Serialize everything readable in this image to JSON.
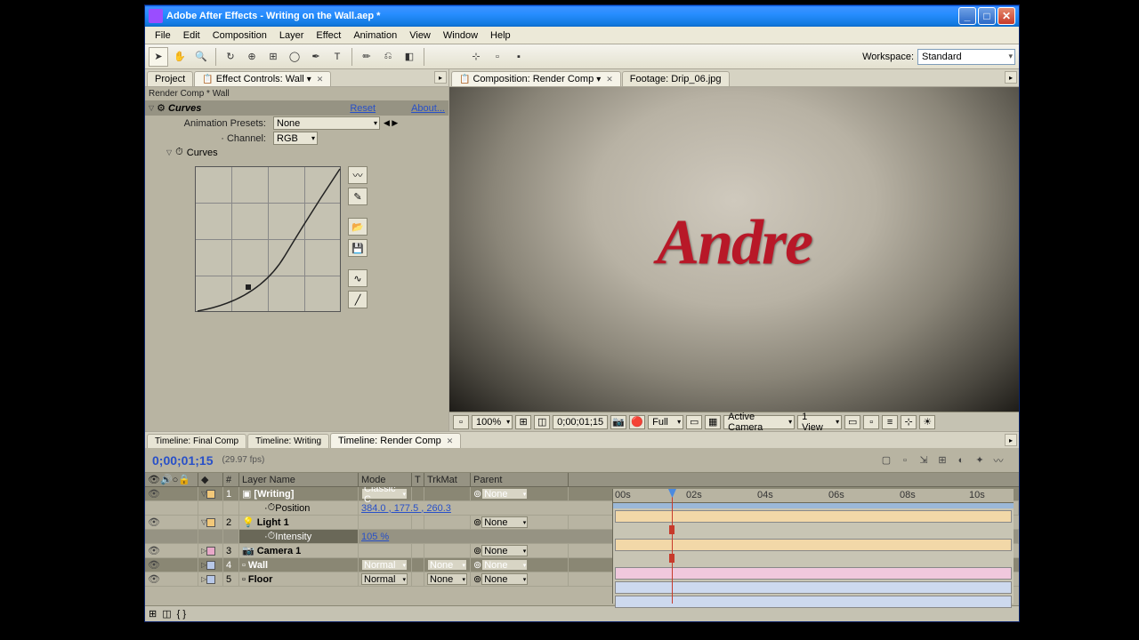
{
  "window": {
    "title": "Adobe After Effects - Writing on the Wall.aep *"
  },
  "menu": [
    "File",
    "Edit",
    "Composition",
    "Layer",
    "Effect",
    "Animation",
    "View",
    "Window",
    "Help"
  ],
  "workspace": {
    "label": "Workspace:",
    "value": "Standard"
  },
  "left_tabs": {
    "project": "Project",
    "effect": "Effect Controls: Wall"
  },
  "effect": {
    "breadcrumb": "Render Comp * Wall",
    "name": "Curves",
    "reset": "Reset",
    "about": "About...",
    "presets_label": "Animation Presets:",
    "presets_value": "None",
    "channel_label": "Channel:",
    "channel_value": "RGB",
    "curves_label": "Curves"
  },
  "comp_tabs": {
    "comp": "Composition: Render Comp",
    "footage": "Footage: Drip_06.jpg"
  },
  "graffiti_text": "Andre",
  "viewer": {
    "zoom": "100%",
    "time": "0;00;01;15",
    "res": "Full",
    "camera": "Active Camera",
    "views": "1 View"
  },
  "tl_tabs": [
    "Timeline: Final Comp",
    "Timeline: Writing",
    "Timeline: Render Comp"
  ],
  "tl": {
    "timecode": "0;00;01;15",
    "fps": "(29.97 fps)",
    "col_num": "#",
    "col_name": "Layer Name",
    "col_mode": "Mode",
    "col_t": "T",
    "col_trk": "TrkMat",
    "col_parent": "Parent"
  },
  "layers": [
    {
      "n": "1",
      "name": "[Writing]",
      "mode": "Classic C",
      "trk": "",
      "parent": "None",
      "color": "#f2c879"
    },
    {
      "prop": "Position",
      "val": "384.0 , 177.5 , 260.3"
    },
    {
      "n": "2",
      "name": "Light 1",
      "mode": "",
      "trk": "",
      "parent": "None",
      "color": "#f2c879"
    },
    {
      "prop": "Intensity",
      "val": "105 %"
    },
    {
      "n": "3",
      "name": "Camera 1",
      "mode": "",
      "trk": "",
      "parent": "None",
      "color": "#e8a8c8"
    },
    {
      "n": "4",
      "name": "Wall",
      "mode": "Normal",
      "trk": "None",
      "parent": "None",
      "color": "#b8c8e8"
    },
    {
      "n": "5",
      "name": "Floor",
      "mode": "Normal",
      "trk": "None",
      "parent": "None",
      "color": "#b8c8e8"
    }
  ],
  "ruler": [
    "00s",
    "02s",
    "04s",
    "06s",
    "08s",
    "10s"
  ]
}
